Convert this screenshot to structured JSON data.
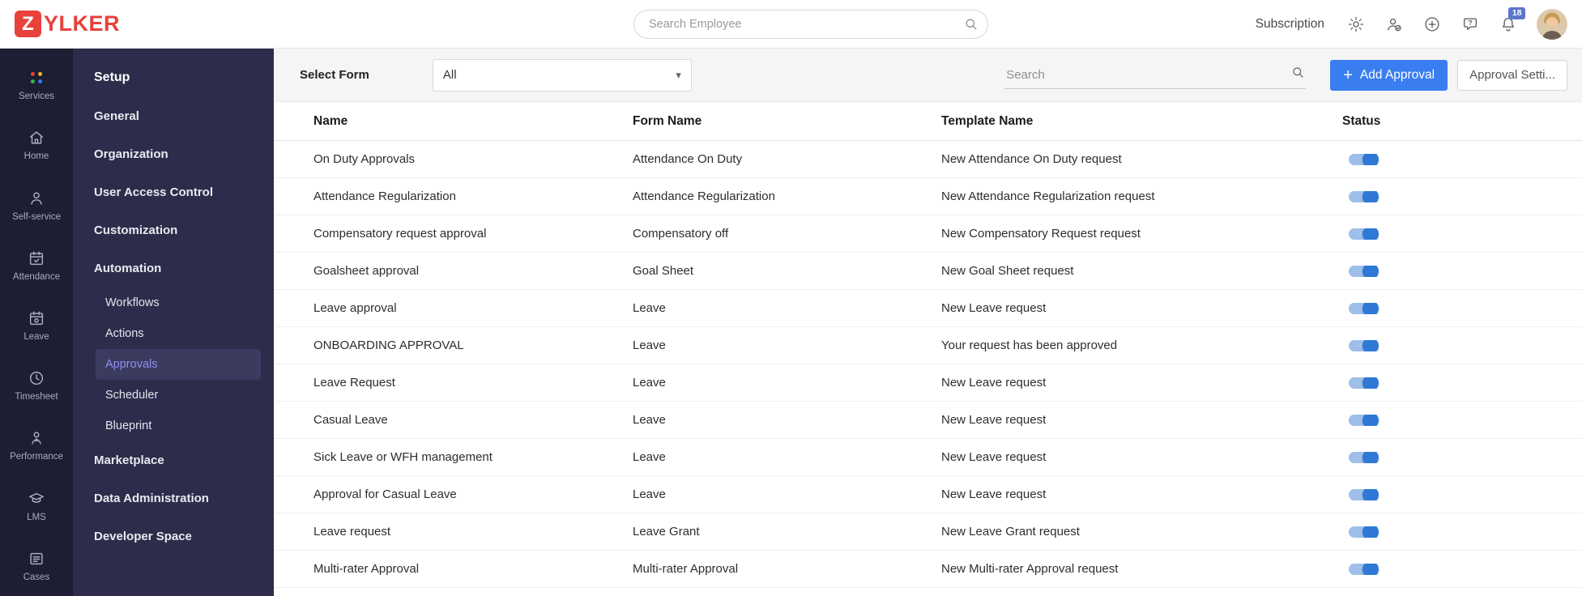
{
  "brand": {
    "logo_letter": "Z",
    "logo_rest": "YLKER"
  },
  "header": {
    "search_placeholder": "Search Employee",
    "subscription_label": "Subscription",
    "notification_count": "18"
  },
  "rail": {
    "items": [
      {
        "label": "Services"
      },
      {
        "label": "Home"
      },
      {
        "label": "Self-service"
      },
      {
        "label": "Attendance"
      },
      {
        "label": "Leave"
      },
      {
        "label": "Timesheet"
      },
      {
        "label": "Performance"
      },
      {
        "label": "LMS"
      },
      {
        "label": "Cases"
      }
    ]
  },
  "sidebar": {
    "items": [
      {
        "label": "Setup",
        "type": "title"
      },
      {
        "label": "General",
        "type": "item"
      },
      {
        "label": "Organization",
        "type": "item"
      },
      {
        "label": "User Access Control",
        "type": "item"
      },
      {
        "label": "Customization",
        "type": "item"
      },
      {
        "label": "Automation",
        "type": "item"
      },
      {
        "label": "Workflows",
        "type": "sub"
      },
      {
        "label": "Actions",
        "type": "sub"
      },
      {
        "label": "Approvals",
        "type": "sub",
        "active": true
      },
      {
        "label": "Scheduler",
        "type": "sub"
      },
      {
        "label": "Blueprint",
        "type": "sub"
      },
      {
        "label": "Marketplace",
        "type": "item"
      },
      {
        "label": "Data Administration",
        "type": "item"
      },
      {
        "label": "Developer Space",
        "type": "item"
      }
    ]
  },
  "toolbar": {
    "select_form_label": "Select Form",
    "form_filter_value": "All",
    "search_placeholder": "Search",
    "add_button_label": "Add Approval",
    "settings_button_label": "Approval Setti..."
  },
  "icons": {
    "plus": "+",
    "chevron_down": "▾"
  },
  "table": {
    "columns": [
      "Name",
      "Form Name",
      "Template Name",
      "Status"
    ],
    "rows": [
      {
        "name": "On Duty Approvals",
        "form": "Attendance On Duty",
        "template": "New Attendance On Duty request",
        "status_on": true
      },
      {
        "name": "Attendance Regularization",
        "form": "Attendance Regularization",
        "template": "New Attendance Regularization request",
        "status_on": true
      },
      {
        "name": "Compensatory request approval",
        "form": "Compensatory off",
        "template": "New Compensatory Request request",
        "status_on": true
      },
      {
        "name": "Goalsheet approval",
        "form": "Goal Sheet",
        "template": "New Goal Sheet request",
        "status_on": true
      },
      {
        "name": "Leave approval",
        "form": "Leave",
        "template": "New Leave request",
        "status_on": true
      },
      {
        "name": "ONBOARDING APPROVAL",
        "form": "Leave",
        "template": "Your request has been approved",
        "status_on": true
      },
      {
        "name": "Leave Request",
        "form": "Leave",
        "template": "New Leave request",
        "status_on": true
      },
      {
        "name": "Casual Leave",
        "form": "Leave",
        "template": "New Leave request",
        "status_on": true
      },
      {
        "name": "Sick Leave or WFH management",
        "form": "Leave",
        "template": "New Leave request",
        "status_on": true
      },
      {
        "name": "Approval for Casual Leave",
        "form": "Leave",
        "template": "New Leave request",
        "status_on": true
      },
      {
        "name": "Leave request",
        "form": "Leave Grant",
        "template": "New Leave Grant request",
        "status_on": true
      },
      {
        "name": "Multi-rater Approval",
        "form": "Multi-rater Approval",
        "template": "New Multi-rater Approval request",
        "status_on": true
      }
    ]
  },
  "colors": {
    "brand_red": "#e8413c",
    "accent_blue": "#3a7df0",
    "toggle_on": "#2f78d6",
    "toggle_track": "#9dbfea",
    "rail_bg": "#1d1d33",
    "sidebar_bg": "#2d2d4b",
    "active_link": "#8f8ff2",
    "badge_bg": "#5b76cb"
  }
}
